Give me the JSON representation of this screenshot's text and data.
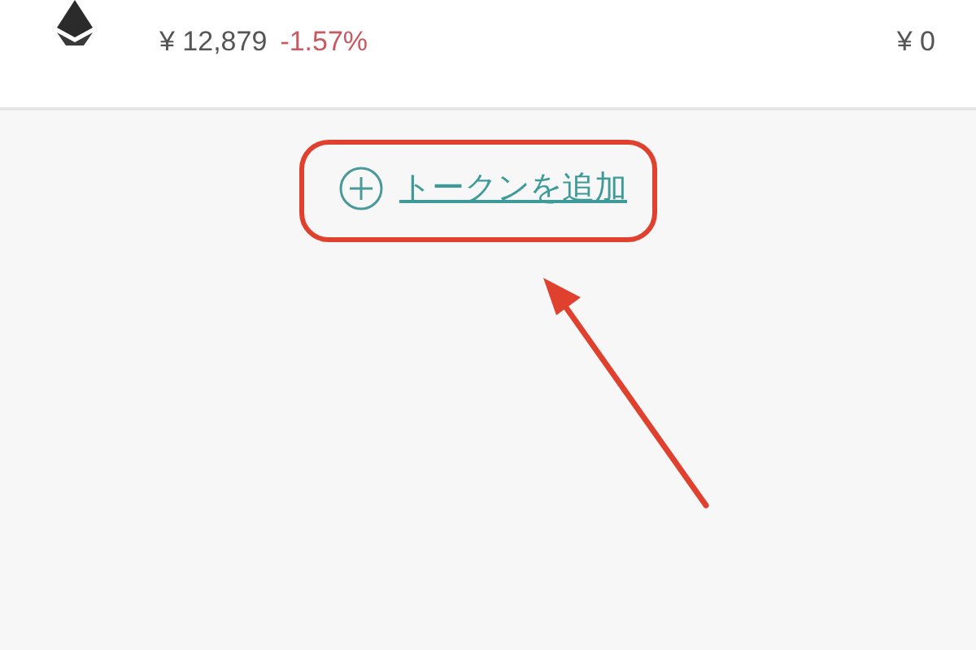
{
  "asset": {
    "price": "¥ 12,879",
    "change": "-1.57%",
    "value": "¥ 0"
  },
  "add_token": {
    "label": "トークンを追加"
  },
  "annotations": {
    "outline": true,
    "arrow": true
  }
}
